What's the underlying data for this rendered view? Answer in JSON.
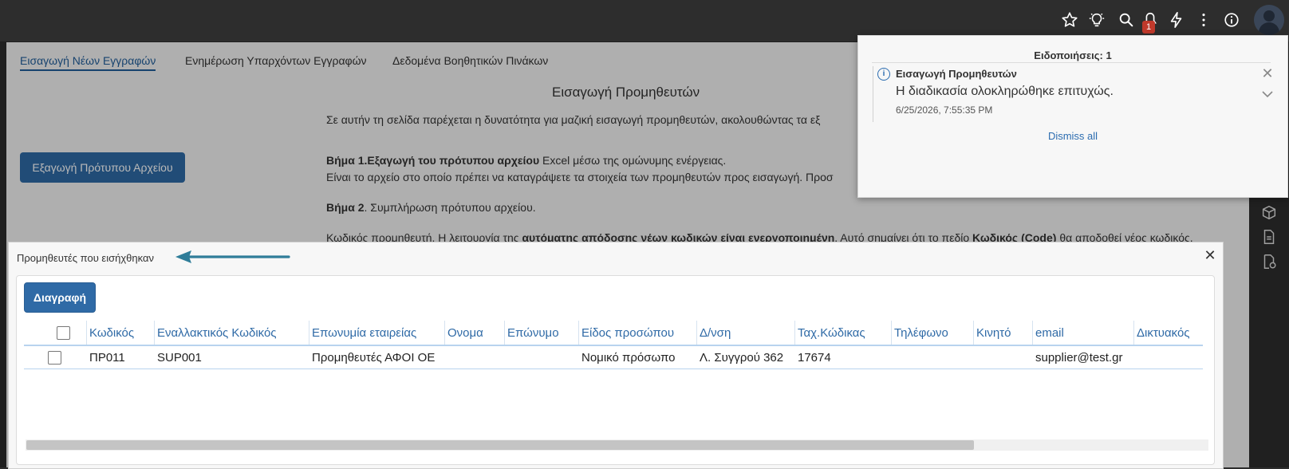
{
  "colors": {
    "accent": "#2f6aa6",
    "badge": "#c0392b",
    "link": "#2b6cb0"
  },
  "topbar": {
    "icons": [
      "star-icon",
      "lightbulb-icon",
      "search-icon",
      "bell-icon",
      "bolt-icon",
      "more-icon",
      "info-icon",
      "avatar"
    ],
    "badge_count": "1"
  },
  "tabs": [
    {
      "label": "Εισαγωγή Νέων Εγγραφών",
      "active": true
    },
    {
      "label": "Ενημέρωση Υπαρχόντων Εγγραφών",
      "active": false
    },
    {
      "label": "Δεδομένα Βοηθητικών Πινάκων",
      "active": false
    }
  ],
  "page": {
    "title": "Εισαγωγή Προμηθευτών",
    "intro": "Σε αυτήν τη σελίδα παρέχεται η δυνατότητα για μαζική εισαγωγή προμηθευτών, ακολουθώντας τα εξ",
    "step1_bold": "Βήμα 1.Εξαγωγή του πρότυπου αρχείου",
    "step1_rest": " Excel μέσω της ομώνυμης ενέργειας.",
    "step1_line2": "Είναι το αρχείο στο οποίο πρέπει να καταγράψετε τα στοιχεία των προμηθευτών προς εισαγωγή. Προσ",
    "step2_bold": "Βήμα 2",
    "step2_rest": ". Συμπλήρωση πρότυπου αρχείου.",
    "code_line_a": "Κωδικός προμηθευτή. Η λειτουργία της ",
    "code_line_b": "αυτόματης απόδοσης νέων κωδικών είναι ενεργοποιημένη",
    "code_line_c": ". Αυτό σημαίνει ότι το πεδίο ",
    "code_line_d": "Κωδικός (Code)",
    "code_line_e": " θα αποδοθεί νέος κωδικός.",
    "export_button": "Εξαγωγή Πρότυπου Αρχείου"
  },
  "notifications": {
    "title": "Ειδοποιήσεις: 1",
    "item": {
      "source": "Εισαγωγή Προμηθευτών",
      "message": "Η διαδικασία ολοκληρώθηκε επιτυχώς.",
      "time": "6/25/2026, 7:55:35 PM"
    },
    "dismiss_all": "Dismiss all"
  },
  "dialog": {
    "title": "Προμηθευτές που εισήχθηκαν",
    "delete_button": "Διαγραφή",
    "columns": [
      "Κωδικός",
      "Εναλλακτικός Κωδικός",
      "Επωνυμία εταιρείας",
      "Ονομα",
      "Επώνυμο",
      "Είδος προσώπου",
      "Δ/νση",
      "Ταχ.Κώδικας",
      "Τηλέφωνο",
      "Κινητό",
      "email",
      "Δικτυακός"
    ],
    "rows": [
      [
        "ΠΡ011",
        "SUP001",
        "Προμηθευτές ΑΦΟΙ ΟΕ",
        "",
        "",
        "Νομικό πρόσωπο",
        "Λ. Συγγρού 362",
        "17674",
        "",
        "",
        "supplier@test.gr",
        ""
      ]
    ]
  }
}
